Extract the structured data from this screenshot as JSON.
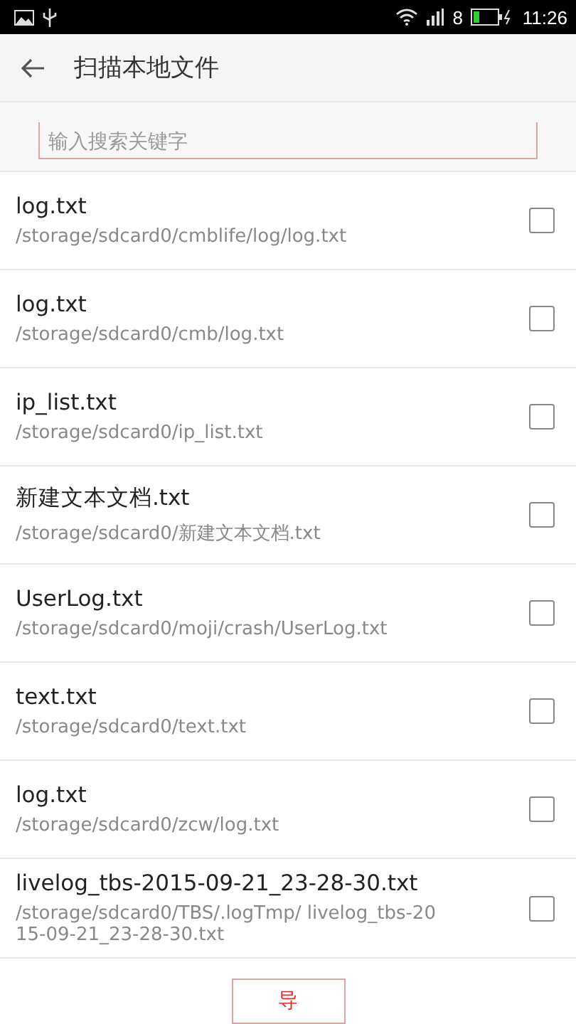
{
  "status_bar": {
    "time": "11:26",
    "battery_text": "8"
  },
  "header": {
    "title": "扫描本地文件"
  },
  "search": {
    "placeholder": "输入搜索关键字"
  },
  "files": [
    {
      "name": "log.txt",
      "path": "/storage/sdcard0/cmblife/log/log.txt",
      "checked": false
    },
    {
      "name": "log.txt",
      "path": "/storage/sdcard0/cmb/log.txt",
      "checked": false
    },
    {
      "name": "ip_list.txt",
      "path": "/storage/sdcard0/ip_list.txt",
      "checked": false
    },
    {
      "name": "新建文本文档.txt",
      "path": "/storage/sdcard0/新建文本文档.txt",
      "checked": false
    },
    {
      "name": "UserLog.txt",
      "path": "/storage/sdcard0/moji/crash/UserLog.txt",
      "checked": false
    },
    {
      "name": "text.txt",
      "path": "/storage/sdcard0/text.txt",
      "checked": false
    },
    {
      "name": "log.txt",
      "path": "/storage/sdcard0/zcw/log.txt",
      "checked": false
    },
    {
      "name": "livelog_tbs-2015-09-21_23-28-30.txt",
      "path": "/storage/sdcard0/TBS/.logTmp/ livelog_tbs-2015-09-21_23-28-30.txt",
      "checked": false
    }
  ],
  "buttons": [
    {
      "label": "导"
    }
  ]
}
